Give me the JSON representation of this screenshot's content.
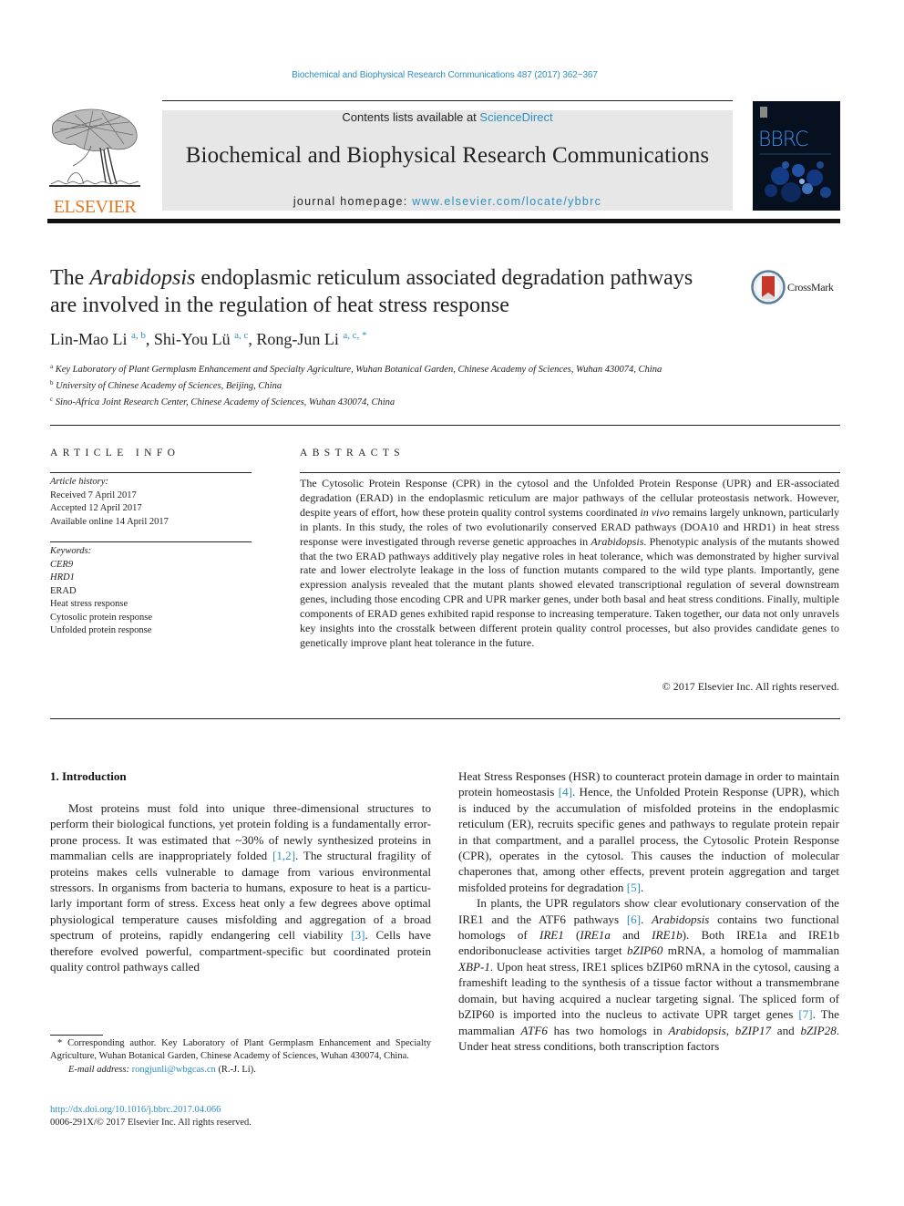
{
  "header": {
    "citation": "Biochemical and Biophysical Research Communications 487 (2017) 362−367",
    "contents_prefix": "Contents lists available at ",
    "contents_link": "ScienceDirect",
    "journal_name": "Biochemical and Biophysical Research Communications",
    "homepage_prefix": "journal homepage: ",
    "homepage_link": "www.elsevier.com/locate/ybbrc",
    "publisher_logo": "ELSEVIER",
    "cover_title": "BBRC",
    "crossmark_label": "CrossMark",
    "colors": {
      "link": "#2e8fc0",
      "elsevier_orange": "#e87722",
      "header_box": "#e7e7e7"
    }
  },
  "article": {
    "title_pre": "The ",
    "title_italic": "Arabidopsis",
    "title_post": " endoplasmic reticulum associated degradation pathways are involved in the regulation of heat stress response",
    "authors": [
      {
        "name": "Lin-Mao Li",
        "sup": "a, b"
      },
      {
        "name": "Shi-You Lü",
        "sup": "a, c"
      },
      {
        "name": "Rong-Jun Li",
        "sup": "a, c, *"
      }
    ],
    "affiliations": [
      {
        "mark": "a",
        "text": "Key Laboratory of Plant Germplasm Enhancement and Specialty Agriculture, Wuhan Botanical Garden, Chinese Academy of Sciences, Wuhan 430074, China"
      },
      {
        "mark": "b",
        "text": "University of Chinese Academy of Sciences, Beijing, China"
      },
      {
        "mark": "c",
        "text": "Sino-Africa Joint Research Center, Chinese Academy of Sciences, Wuhan 430074, China"
      }
    ]
  },
  "article_info": {
    "heading": "ARTICLE INFO",
    "history_label": "Article history:",
    "history": [
      "Received 7 April 2017",
      "Accepted 12 April 2017",
      "Available online 14 April 2017"
    ],
    "keywords_label": "Keywords:",
    "keywords": [
      {
        "text": "CER9",
        "italic": true
      },
      {
        "text": "HRD1",
        "italic": true
      },
      {
        "text": "ERAD",
        "italic": false
      },
      {
        "text": "Heat stress response",
        "italic": false
      },
      {
        "text": "Cytosolic protein response",
        "italic": false
      },
      {
        "text": "Unfolded protein response",
        "italic": false
      }
    ]
  },
  "abstract": {
    "heading": "ABSTRACTS",
    "p1": "The Cytosolic Protein Response (CPR) in the cytosol and the Unfolded Protein Response (UPR) and ER-associated degradation (ERAD) in the endoplasmic reticulum are major pathways of the cellular pro­teostasis network. However, despite years of effort, how these protein quality control systems coordi­nated ",
    "p1_italic": "in vivo",
    "p2": " remains largely unknown, particularly in plants. In this study, the roles of two evolutionarily conserved ERAD pathways (DOA10 and HRD1) in heat stress response were investigated through reverse genetic approaches in ",
    "p2_italic": "Arabidopsis",
    "p3": ". Phenotypic analysis of the mutants showed that the two ERAD pathways additively play negative roles in heat tolerance, which was demonstrated by higher survival rate and lower electrolyte leakage in the loss of function mutants compared to the wild type plants. Importantly, gene expression analysis revealed that the mutant plants showed elevated transcriptional regulation of several downstream genes, including those encoding CPR and UPR marker genes, under both basal and heat stress conditions. Finally, multiple components of ERAD genes exhibited rapid response to increasing temperature. Taken together, our data not only unravels key insights into the crosstalk between different protein quality control processes, but also provides candidate genes to genetically improve plant heat tolerance in the future.",
    "copyright": "© 2017 Elsevier Inc. All rights reserved."
  },
  "intro": {
    "heading": "1.  Introduction",
    "left": {
      "s1": "Most proteins must fold into unique three-dimensional struc­tures to perform their biological functions, yet protein folding is a fundamentally error-prone process. It was estimated that ~30% of newly synthesized proteins in mammalian cells are inappropriately folded ",
      "ref1": "[1,2]",
      "s2": ". The structural fragility of proteins makes cells vulnerable to damage from various environmental stressors. In organisms from bacteria to humans, exposure to heat is a particu­larly important form of stress. Excess heat only a few degrees above optimal physiological temperature causes misfolding and aggre­gation of a broad spectrum of proteins, rapidly endangering cell viability ",
      "ref2": "[3]",
      "s3": ". Cells have therefore evolved powerful, compartment-specific but coordinated protein quality control pathways called"
    },
    "right": {
      "a1": "Heat Stress Responses (HSR) to counteract protein damage in order to maintain protein homeostasis ",
      "aref1": "[4]",
      "a2": ". Hence, the Unfolded Protein Response (UPR), which is induced by the accumulation of misfolded proteins in the endoplasmic reticulum (ER), recruits specific genes and pathways to regulate protein repair in that compartment, and a parallel process, the Cytosolic Protein Response (CPR), operates in the cytosol. This causes the induction of molecular chaperones that, among other effects, prevent protein aggregation and target mis­folded proteins for degradation ",
      "aref2": "[5]",
      "a3": ".",
      "b1": "In plants, the UPR regulators show clear evolutionary conser­vation of the IRE1 and the ATF6 pathways ",
      "bref1": "[6]",
      "b2": ". ",
      "b2i": "Arabidopsis",
      "b3": " contains two functional homologs of ",
      "b3i": "IRE1",
      "b4": " (",
      "b4i": "IRE1a",
      "b5": " and ",
      "b5i": "IRE1b",
      "b6": "). Both IRE1a and IRE1b endoribonuclease activities target ",
      "b6i": "bZIP60",
      "b7": " mRNA, a homolog of mammalian ",
      "b7i": "XBP-1",
      "b8": ". Upon heat stress, IRE1 splices bZIP60 mRNA in the cytosol, causing a frameshift leading to the synthesis of a tissue factor without a transmembrane domain, but having ac­quired a nuclear targeting signal. The spliced form of bZIP60 is imported into the nucleus to activate UPR target genes ",
      "bref2": "[7]",
      "b9": ". The mammalian ",
      "b9i": "ATF6",
      "b10": " has two homologs in ",
      "b10i": "Arabidopsis",
      "b11": ", ",
      "b11i": "bZIP17",
      "b12": " and ",
      "b12i": "bZIP28",
      "b13": ". Under heat stress conditions, both transcription factors"
    }
  },
  "footnote": {
    "corresponding": "* Corresponding author. Key Laboratory of Plant Germplasm Enhancement and Specialty Agriculture, Wuhan Botanical Garden, Chinese Academy of Sciences, Wuhan 430074, China.",
    "email_label": "E-mail address: ",
    "email": "rongjunli@wbgcas.cn",
    "email_suffix": " (R.-J. Li).",
    "doi": "http://dx.doi.org/10.1016/j.bbrc.2017.04.066",
    "issn": "0006-291X/© 2017 Elsevier Inc. All rights reserved."
  }
}
